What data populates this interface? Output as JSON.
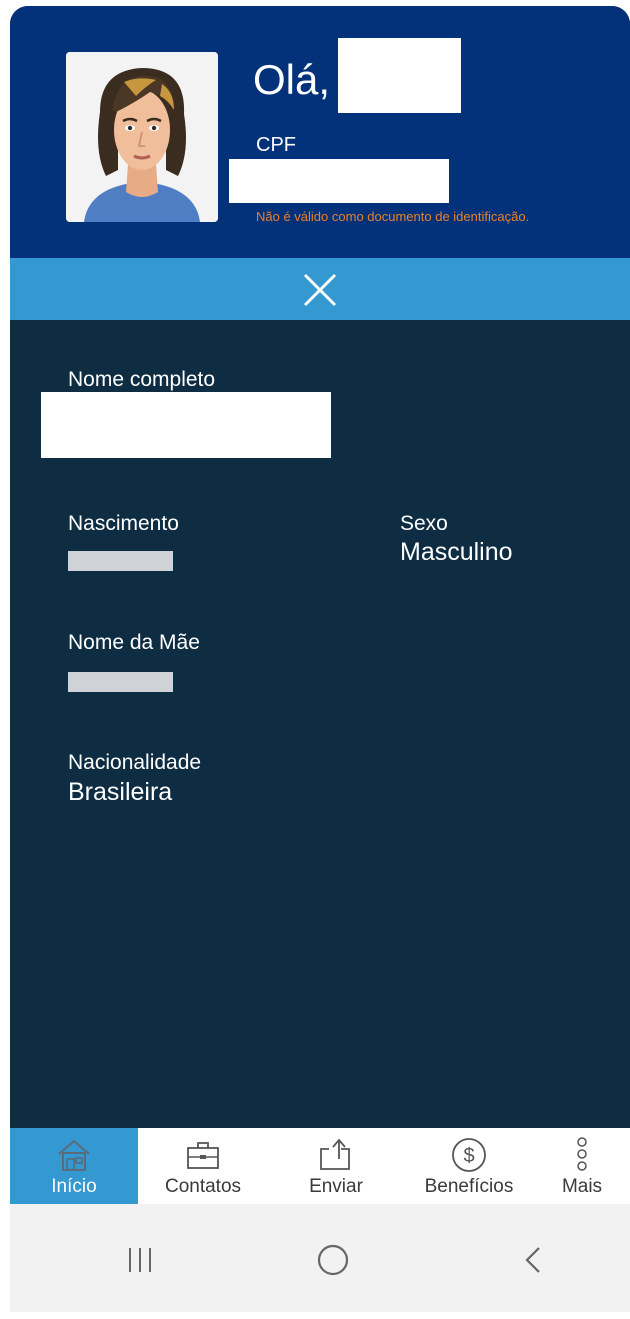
{
  "header": {
    "greeting": "Olá,",
    "cpf_label": "CPF",
    "disclaimer": "Não é válido como documento de identificação."
  },
  "closebar": {
    "icon": "close-icon"
  },
  "fields": {
    "nome_completo_label": "Nome completo",
    "nascimento_label": "Nascimento",
    "sexo_label": "Sexo",
    "sexo_value": "Masculino",
    "nome_mae_label": "Nome da Mãe",
    "nacionalidade_label": "Nacionalidade",
    "nacionalidade_value": "Brasileira"
  },
  "bottomnav": {
    "items": [
      {
        "label": "Início",
        "icon": "home-icon",
        "active": true
      },
      {
        "label": "Contatos",
        "icon": "briefcase-icon",
        "active": false
      },
      {
        "label": "Enviar",
        "icon": "share-icon",
        "active": false
      },
      {
        "label": "Benefícios",
        "icon": "dollar-coin-icon",
        "active": false
      },
      {
        "label": "Mais",
        "icon": "more-vertical-icon",
        "active": false
      }
    ]
  },
  "system_nav": [
    "recent-apps-icon",
    "home-circle-icon",
    "back-chevron-icon"
  ],
  "colors": {
    "header_bg": "#03327a",
    "accent": "#3399d0",
    "body_bg": "#0e2d43",
    "disclaimer": "#e8802a"
  }
}
